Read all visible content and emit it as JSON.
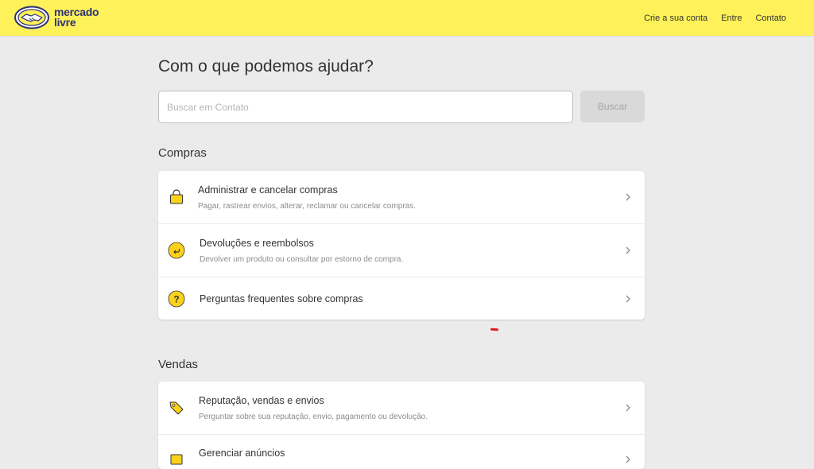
{
  "header": {
    "logo_line1": "mercado",
    "logo_line2": "livre",
    "nav": {
      "create_account": "Crie a sua conta",
      "login": "Entre",
      "contact": "Contato"
    }
  },
  "main": {
    "title": "Com o que podemos ajudar?",
    "search": {
      "placeholder": "Buscar em Contato",
      "button": "Buscar"
    },
    "sections": [
      {
        "title": "Compras",
        "items": [
          {
            "icon": "shopping-bag-icon",
            "title": "Administrar e cancelar compras",
            "subtitle": "Pagar, rastrear envios, alterar, reclamar ou cancelar compras."
          },
          {
            "icon": "return-arrow-icon",
            "title": "Devoluções e reembolsos",
            "subtitle": "Devolver um produto ou consultar por estorno de compra."
          },
          {
            "icon": "question-mark-icon",
            "title": "Perguntas frequentes sobre compras",
            "subtitle": ""
          }
        ]
      },
      {
        "title": "Vendas",
        "items": [
          {
            "icon": "price-tag-icon",
            "title": "Reputação, vendas e envios",
            "subtitle": "Perguntar sobre sua reputação, envio, pagamento ou devolução."
          },
          {
            "icon": "listing-icon",
            "title": "Gerenciar anúncios",
            "subtitle": ""
          }
        ]
      }
    ]
  },
  "colors": {
    "header_bg": "#fff159",
    "page_bg": "#ebebeb",
    "icon_yellow": "#fbd11a",
    "logo_blue": "#2d3277"
  }
}
